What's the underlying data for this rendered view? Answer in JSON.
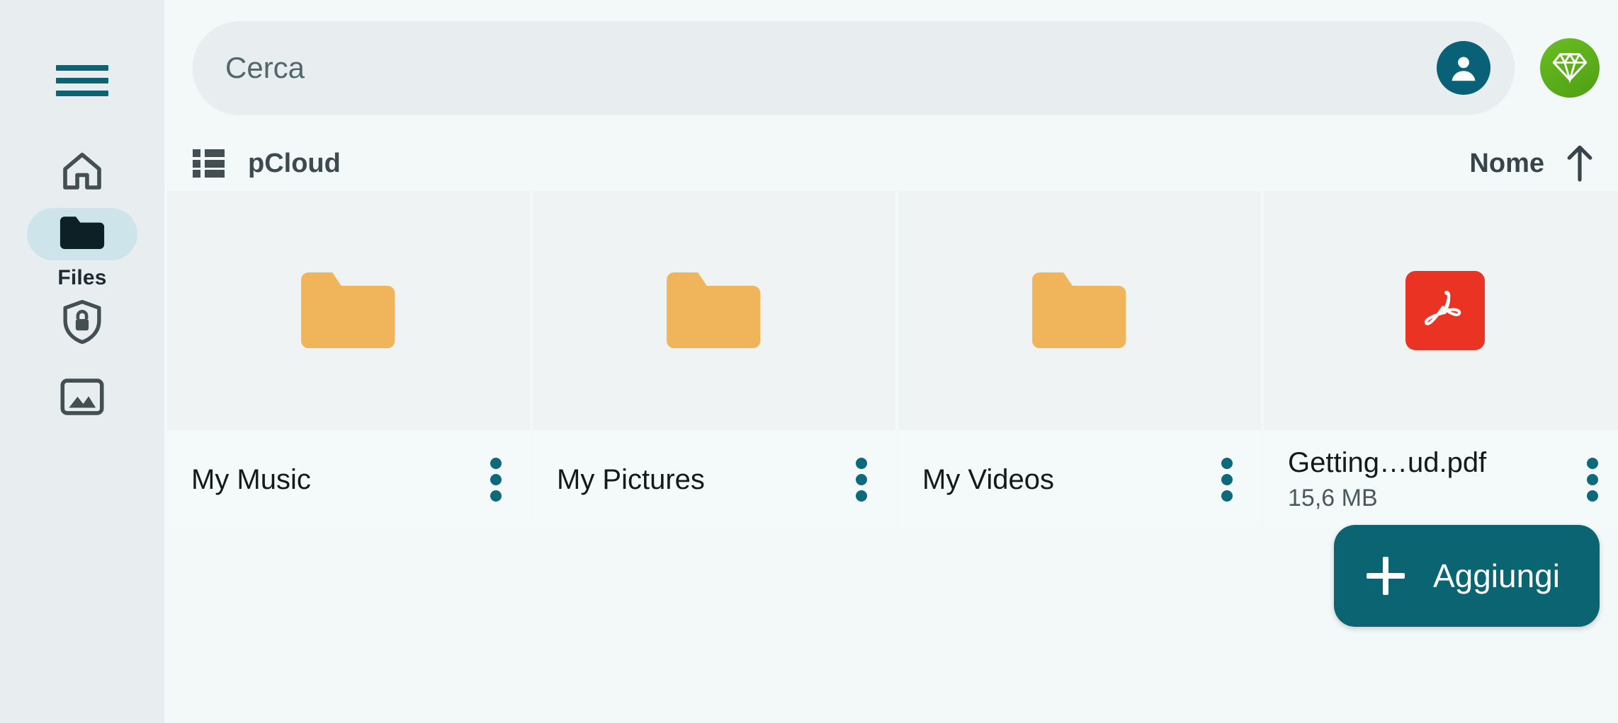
{
  "app": {
    "accent_teal": "#0a6472",
    "accent_green": "#5cb318",
    "sidebar_bg": "#e8edf0",
    "content_bg": "#f3f9f9",
    "folder_color": "#f0b45a",
    "pdf_color": "#ea3323"
  },
  "sidebar": {
    "menu_icon": "hamburger-menu-icon",
    "items": [
      {
        "icon": "home-icon",
        "label": "",
        "active": false
      },
      {
        "icon": "folder-icon",
        "label": "Files",
        "active": true
      },
      {
        "icon": "shield-lock-icon",
        "label": "",
        "active": false
      },
      {
        "icon": "image-icon",
        "label": "",
        "active": false
      }
    ]
  },
  "header": {
    "search": {
      "placeholder": "Cerca",
      "value": ""
    },
    "account_icon": "account-avatar-icon",
    "premium_icon": "diamond-icon"
  },
  "toolbar": {
    "view_toggle_icon": "list-view-icon",
    "breadcrumb": "pCloud",
    "sort_label": "Nome",
    "sort_direction_icon": "arrow-up-icon"
  },
  "files": [
    {
      "name": "My Music",
      "size": "",
      "type": "folder",
      "icon": "folder-icon"
    },
    {
      "name": "My Pictures",
      "size": "",
      "type": "folder",
      "icon": "folder-icon"
    },
    {
      "name": "My Videos",
      "size": "",
      "type": "folder",
      "icon": "folder-icon"
    },
    {
      "name": "Getting…ud.pdf",
      "size": "15,6 MB",
      "type": "pdf",
      "icon": "pdf-icon"
    }
  ],
  "fab": {
    "label": "Aggiungi",
    "icon": "plus-icon"
  }
}
